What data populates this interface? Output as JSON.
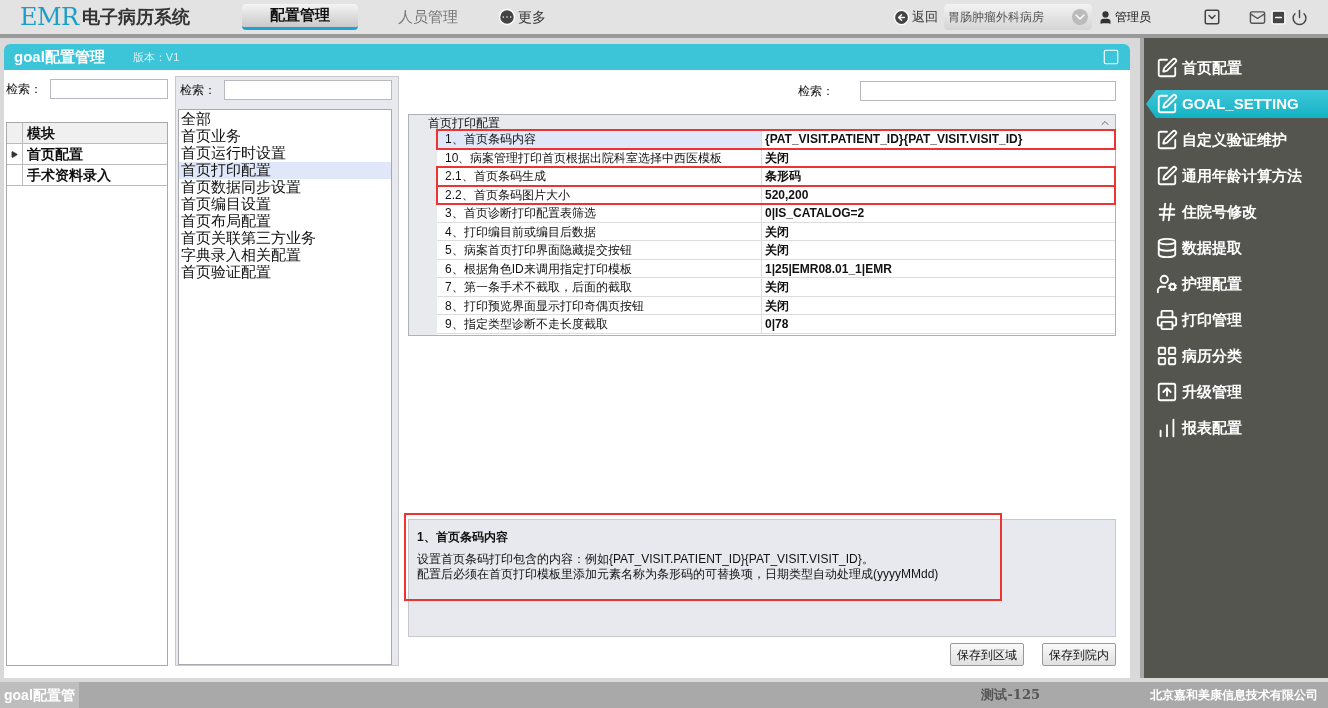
{
  "header": {
    "logo": "EMR",
    "title": "电子病历系统",
    "nav": [
      {
        "label": "配置管理",
        "selected": true
      },
      {
        "label": "人员管理",
        "selected": false
      }
    ],
    "more": "更多",
    "back": "返回",
    "ward": "胃肠肿瘤外科病房",
    "user": "管理员"
  },
  "panel": {
    "title": "goal配置管理",
    "version": "版本：V1"
  },
  "modules": {
    "search_label": "检索：",
    "column": "模块",
    "items": [
      {
        "label": "首页配置",
        "selected": true
      },
      {
        "label": "手术资料录入",
        "selected": false
      }
    ]
  },
  "categories": {
    "search_label": "检索：",
    "items": [
      {
        "label": "全部",
        "selected": false
      },
      {
        "label": "首页业务",
        "selected": false
      },
      {
        "label": "首页运行时设置",
        "selected": false
      },
      {
        "label": "首页打印配置",
        "selected": true
      },
      {
        "label": "首页数据同步设置",
        "selected": false
      },
      {
        "label": "首页编目设置",
        "selected": false
      },
      {
        "label": "首页布局配置",
        "selected": false
      },
      {
        "label": "首页关联第三方业务",
        "selected": false
      },
      {
        "label": "字典录入相关配置",
        "selected": false
      },
      {
        "label": "首页验证配置",
        "selected": false
      }
    ]
  },
  "properties": {
    "search_label": "检索：",
    "group": "首页打印配置",
    "rows": [
      {
        "name": "1、首页条码内容",
        "value": "{PAT_VISIT.PATIENT_ID}{PAT_VISIT.VISIT_ID}",
        "selected": true,
        "annotated": true
      },
      {
        "name": "10、病案管理打印首页根据出院科室选择中西医模板",
        "value": "关闭",
        "selected": false,
        "annotated": false
      },
      {
        "name": "2.1、首页条码生成",
        "value": "条形码",
        "selected": false,
        "annotated": true
      },
      {
        "name": "2.2、首页条码图片大小",
        "value": "520,200",
        "selected": false,
        "annotated": true
      },
      {
        "name": "3、首页诊断打印配置表筛选",
        "value": "0|IS_CATALOG=2",
        "selected": false,
        "annotated": false
      },
      {
        "name": "4、打印编目前或编目后数据",
        "value": "关闭",
        "selected": false,
        "annotated": false
      },
      {
        "name": "5、病案首页打印界面隐藏提交按钮",
        "value": "关闭",
        "selected": false,
        "annotated": false
      },
      {
        "name": "6、根据角色ID来调用指定打印模板",
        "value": "1|25|EMR08.01_1|EMR",
        "selected": false,
        "annotated": false
      },
      {
        "name": "7、第一条手术不截取，后面的截取",
        "value": "关闭",
        "selected": false,
        "annotated": false
      },
      {
        "name": "8、打印预览界面显示打印奇偶页按钮",
        "value": "关闭",
        "selected": false,
        "annotated": false
      },
      {
        "name": "9、指定类型诊断不走长度截取",
        "value": "0|78",
        "selected": false,
        "annotated": false
      }
    ]
  },
  "description": {
    "title": "1、首页条码内容",
    "lines": [
      "设置首页条码打印包含的内容：例如{PAT_VISIT.PATIENT_ID}{PAT_VISIT.VISIT_ID}。",
      "配置后必须在首页打印模板里添加元素名称为条形码的可替换项，日期类型自动处理成(yyyyMMdd)"
    ],
    "annotated": true
  },
  "buttons": [
    "保存到区域",
    "保存到院内"
  ],
  "sidebar": [
    {
      "label": "首页配置",
      "kind": "pen",
      "selected": false
    },
    {
      "label": "GOAL_SETTING",
      "kind": "pen",
      "selected": true
    },
    {
      "label": "自定义验证维护",
      "kind": "pen",
      "selected": false
    },
    {
      "label": "通用年龄计算方法",
      "kind": "pen",
      "selected": false
    },
    {
      "label": "住院号修改",
      "kind": "number",
      "selected": false
    },
    {
      "label": "数据提取",
      "kind": "database",
      "selected": false
    },
    {
      "label": "护理配置",
      "kind": "nurse",
      "selected": false
    },
    {
      "label": "打印管理",
      "kind": "printer",
      "selected": false
    },
    {
      "label": "病历分类",
      "kind": "folder",
      "selected": false
    },
    {
      "label": "升级管理",
      "kind": "upgrade",
      "selected": false
    },
    {
      "label": "报表配置",
      "kind": "chart",
      "selected": false
    }
  ],
  "status_bar": {
    "tab": "goal配置管",
    "user": "测试-125",
    "company": "北京嘉和美康信息技术有限公司"
  }
}
